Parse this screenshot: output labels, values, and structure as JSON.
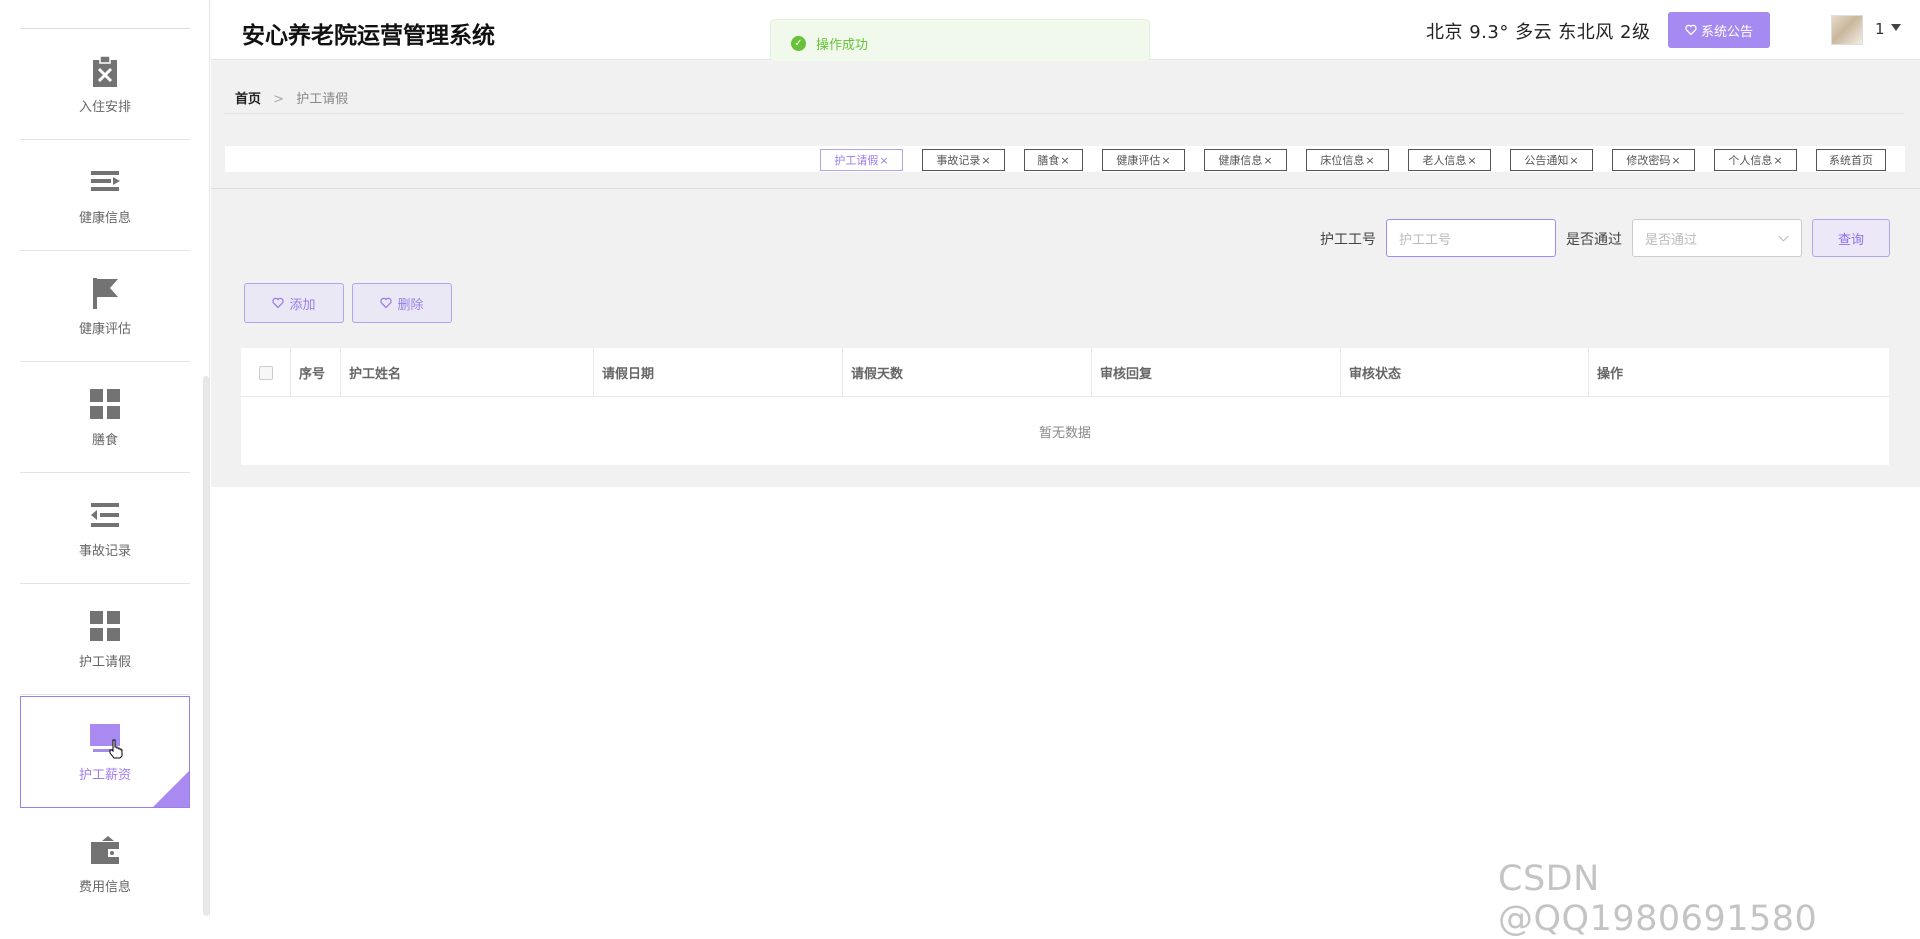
{
  "app": {
    "title": "安心养老院运营管理系统",
    "weather": "北京 9.3° 多云 东北风 2级",
    "notice_button": "系统公告",
    "user_name": "1"
  },
  "toast": {
    "message": "操作成功"
  },
  "sidebar": {
    "items": [
      {
        "label": "入住安排",
        "icon": "clipboard-x-icon"
      },
      {
        "label": "健康信息",
        "icon": "list-arrow-icon"
      },
      {
        "label": "健康评估",
        "icon": "flag-icon"
      },
      {
        "label": "膳食",
        "icon": "grid-icon"
      },
      {
        "label": "事故记录",
        "icon": "indent-list-icon"
      },
      {
        "label": "护工请假",
        "icon": "grid-icon"
      },
      {
        "label": "护工薪资",
        "icon": "square-icon",
        "active": true
      },
      {
        "label": "费用信息",
        "icon": "wallet-icon"
      }
    ]
  },
  "breadcrumb": {
    "home": "首页",
    "separator": ">",
    "current": "护工请假"
  },
  "tags": [
    {
      "label": "护工请假",
      "close": "×",
      "active": true
    },
    {
      "label": "事故记录",
      "close": "×"
    },
    {
      "label": "膳食",
      "close": "×"
    },
    {
      "label": "健康评估",
      "close": "×"
    },
    {
      "label": "健康信息",
      "close": "×"
    },
    {
      "label": "床位信息",
      "close": "×"
    },
    {
      "label": "老人信息",
      "close": "×"
    },
    {
      "label": "公告通知",
      "close": "×"
    },
    {
      "label": "修改密码",
      "close": "×"
    },
    {
      "label": "个人信息",
      "close": "×"
    },
    {
      "label": "系统首页",
      "close": ""
    }
  ],
  "search": {
    "worker_id_label": "护工工号",
    "worker_id_placeholder": "护工工号",
    "approved_label": "是否通过",
    "approved_placeholder": "是否通过",
    "query_button": "查询"
  },
  "actions": {
    "add": "添加",
    "delete": "删除"
  },
  "table": {
    "columns": [
      "序号",
      "护工姓名",
      "请假日期",
      "请假天数",
      "审核回复",
      "审核状态",
      "操作"
    ],
    "empty_text": "暂无数据"
  },
  "watermark": "CSDN @QQ1980691580",
  "colors": {
    "accent": "#a58af2",
    "success": "#67c23a"
  }
}
